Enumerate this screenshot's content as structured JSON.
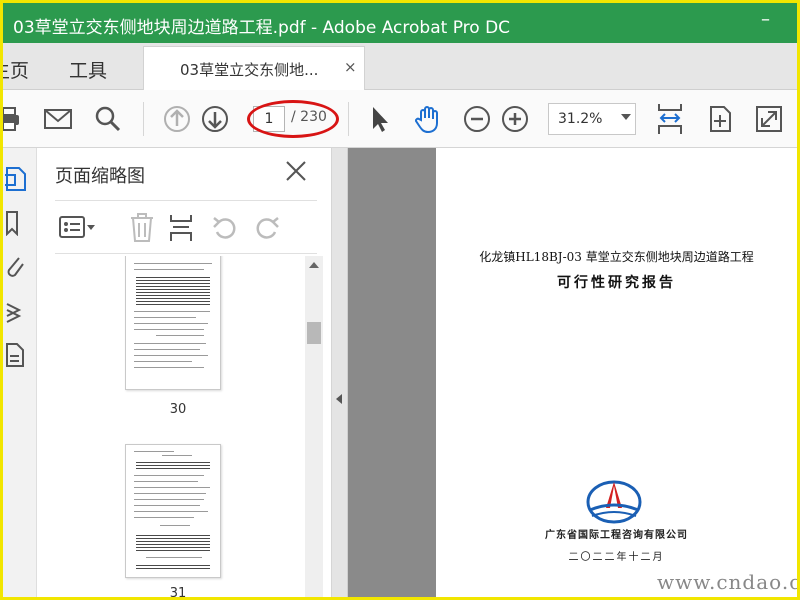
{
  "window": {
    "title": "03草堂立交东侧地块周边道路工程.pdf - Adobe Acrobat Pro DC",
    "minimize": "–"
  },
  "tabs": {
    "home": "主页",
    "tools": "工具",
    "document": "03草堂立交东侧地...",
    "close": "×"
  },
  "toolbar": {
    "page_current": "1",
    "page_total": "/ 230",
    "zoom": "31.2%"
  },
  "panel": {
    "title": "页面缩略图",
    "thumbnails": [
      {
        "page": "30"
      },
      {
        "page": "31"
      }
    ]
  },
  "document": {
    "heading": "化龙镇HL18BJ-03 草堂立交东侧地块周边道路工程",
    "subheading": "可行性研究报告",
    "organization": "广东省国际工程咨询有限公司",
    "date": "二〇二二年十二月"
  },
  "watermark": {
    "corner": "www.cndao.com"
  },
  "colors": {
    "titlebar": "#2c9a4e",
    "frame": "#f2e600",
    "highlight_oval": "#d81414",
    "active_icon": "#1d6fd1"
  }
}
